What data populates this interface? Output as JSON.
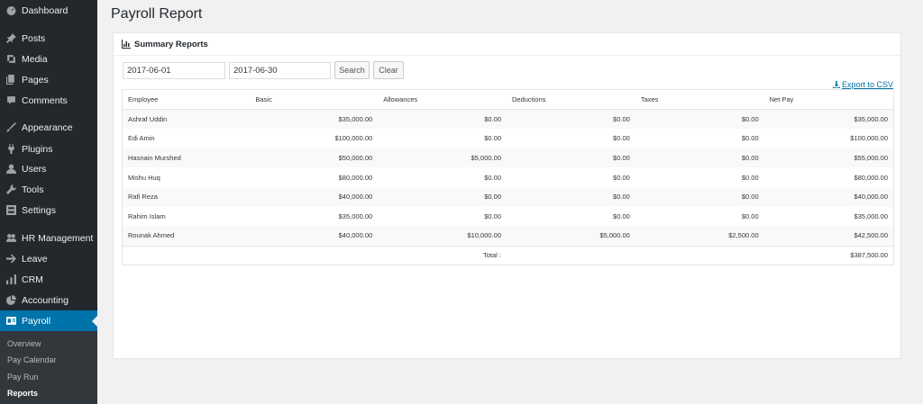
{
  "sidebar": {
    "items": [
      {
        "label": "Dashboard",
        "icon": "dashboard-icon"
      },
      {
        "label": "Posts",
        "icon": "pin-icon"
      },
      {
        "label": "Media",
        "icon": "media-icon"
      },
      {
        "label": "Pages",
        "icon": "pages-icon"
      },
      {
        "label": "Comments",
        "icon": "comment-icon"
      },
      {
        "label": "Appearance",
        "icon": "brush-icon"
      },
      {
        "label": "Plugins",
        "icon": "plugin-icon"
      },
      {
        "label": "Users",
        "icon": "user-icon"
      },
      {
        "label": "Tools",
        "icon": "wrench-icon"
      },
      {
        "label": "Settings",
        "icon": "settings-icon"
      },
      {
        "label": "HR Management",
        "icon": "group-icon"
      },
      {
        "label": "Leave",
        "icon": "arrow-right-icon"
      },
      {
        "label": "CRM",
        "icon": "bar-chart-icon"
      },
      {
        "label": "Accounting",
        "icon": "pie-chart-icon"
      },
      {
        "label": "Payroll",
        "icon": "id-card-icon"
      }
    ],
    "submenu": [
      "Overview",
      "Pay Calendar",
      "Pay Run",
      "Reports"
    ]
  },
  "page": {
    "title": "Payroll Report"
  },
  "panel": {
    "title": "Summary Reports",
    "start_date": "2017-06-01",
    "end_date": "2017-06-30",
    "search_label": "Search",
    "clear_label": "Clear",
    "export_label": "Export to CSV"
  },
  "table": {
    "headers": [
      "Employee",
      "Basic",
      "Allowances",
      "Deductions",
      "Taxes",
      "Net Pay"
    ],
    "rows": [
      [
        "Ashraf Uddin",
        "$35,000.00",
        "$0.00",
        "$0.00",
        "$0.00",
        "$35,000.00"
      ],
      [
        "Edi Amin",
        "$100,000.00",
        "$0.00",
        "$0.00",
        "$0.00",
        "$100,000.00"
      ],
      [
        "Hasnain Murshed",
        "$50,000.00",
        "$5,000.00",
        "$0.00",
        "$0.00",
        "$55,000.00"
      ],
      [
        "Mishu Huq",
        "$80,000.00",
        "$0.00",
        "$0.00",
        "$0.00",
        "$80,000.00"
      ],
      [
        "Rafi Reza",
        "$40,000.00",
        "$0.00",
        "$0.00",
        "$0.00",
        "$40,000.00"
      ],
      [
        "Rahim Islam",
        "$35,000.00",
        "$0.00",
        "$0.00",
        "$0.00",
        "$35,000.00"
      ],
      [
        "Rounak Ahmed",
        "$40,000.00",
        "$10,000.00",
        "$5,000.00",
        "$2,500.00",
        "$42,500.00"
      ]
    ],
    "total_label": "Total :",
    "total_value": "$387,500.00"
  },
  "colors": {
    "sidebar": "#23282d",
    "active": "#0073aa",
    "submenu": "#32373c",
    "link": "#0073aa"
  }
}
